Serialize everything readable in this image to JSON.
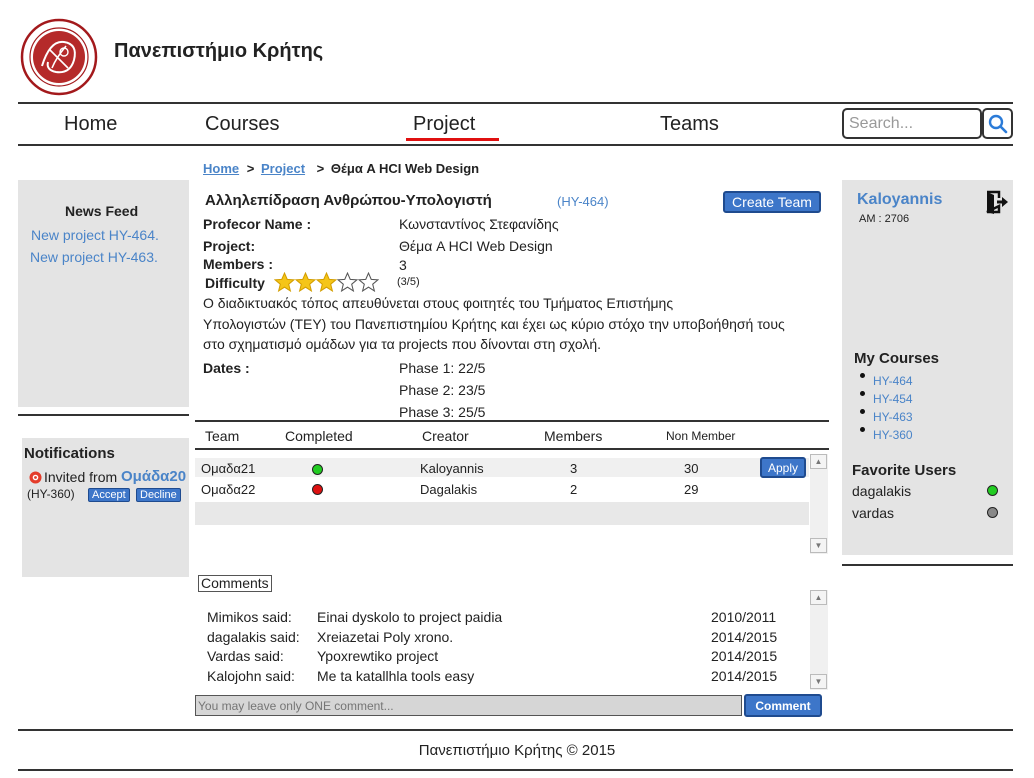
{
  "header": {
    "site_title": "Πανεπιστήμιο Κρήτης"
  },
  "nav": {
    "home": "Home",
    "courses": "Courses",
    "project": "Project",
    "teams": "Teams",
    "search_placeholder": "Search..."
  },
  "news": {
    "title": "News Feed",
    "items": [
      "New project HY-464.",
      "New project HY-463."
    ]
  },
  "notifications": {
    "title": "Notifications",
    "invited_from": "Invited from",
    "team": "Ομάδα20",
    "course": "(HY-360)",
    "accept": "Accept",
    "decline": "Decline"
  },
  "breadcrumb": {
    "home": "Home",
    "sep1": ">",
    "project": "Project",
    "sep2": ">",
    "current": "Θέμα A HCI Web Design"
  },
  "project": {
    "course_title": "Αλληλεπίδραση Ανθρώπου-Υπολογιστή",
    "course_code": "(HY-464)",
    "create_team": "Create Team",
    "professor_label": "Profecor Name :",
    "professor_value": "Κωνσταντίνος Στεφανίδης",
    "project_label": "Project:",
    "project_value": "Θέμα A HCI Web Design",
    "members_label": "Members :",
    "members_value": "3",
    "difficulty_label": "Difficulty",
    "difficulty_text": "(3/5)",
    "difficulty_rating": 3,
    "difficulty_max": 5,
    "description_lines": [
      "Ο διαδικτυακός τόπος απευθύνεται  στους φοιτητές του Τμήματος Επιστήμης",
      "Υπολογιστών (ΤΕΥ)  του Πανεπιστημίου Κρήτης και   έχει ως κύριο στόχο την υποβοήθησή τους",
      "στο σχηματισμό ομάδων για τα projects που  δίνονται στη σχολή."
    ],
    "dates_label": "Dates :",
    "phases": [
      "Phase 1: 22/5",
      "Phase 2: 23/5",
      "Phase 3: 25/5"
    ]
  },
  "teams_table": {
    "headers": [
      "Team",
      "Completed",
      "Creator",
      "Members",
      "Non Member"
    ],
    "apply": "Apply",
    "rows": [
      {
        "team": "Ομαδα21",
        "status": "green",
        "creator": "Kaloyannis",
        "members": "3",
        "non_member": "30"
      },
      {
        "team": "Ομαδα22",
        "status": "red",
        "creator": "Dagalakis",
        "members": "2",
        "non_member": "29"
      }
    ]
  },
  "comments": {
    "title": "Comments",
    "rows": [
      {
        "user": "Mimikos said:",
        "text": "Einai dyskolo to project paidia",
        "year": "2010/2011"
      },
      {
        "user": "dagalakis said:",
        "text": "Xreiazetai Poly xrono.",
        "year": "2014/2015"
      },
      {
        "user": "Vardas said:",
        "text": "Ypoxrewtiko project",
        "year": "2014/2015"
      },
      {
        "user": "Kalojohn said:",
        "text": "Me ta katallhla tools easy",
        "year": "2014/2015"
      }
    ],
    "placeholder": "You may leave only ONE comment...",
    "submit": "Comment"
  },
  "user": {
    "name": "Kaloyannis",
    "am": "AM : 2706",
    "my_courses_title": "My Courses",
    "courses": [
      "HY-464",
      "HY-454",
      "HY-463",
      "HY-360"
    ],
    "favorites_title": "Favorite Users",
    "favorites": [
      {
        "name": "dagalakis",
        "status": "online"
      },
      {
        "name": "vardas",
        "status": "offline"
      }
    ]
  },
  "footer": {
    "text": "Πανεπιστήμιο Κρήτης © 2015"
  },
  "colors": {
    "link": "#4a84c8",
    "button": "#3d76c9",
    "nav_active": "#e01010",
    "online": "#22cc22",
    "offline": "#888888",
    "danger": "#dd1111",
    "panel": "#e4e4e4"
  }
}
